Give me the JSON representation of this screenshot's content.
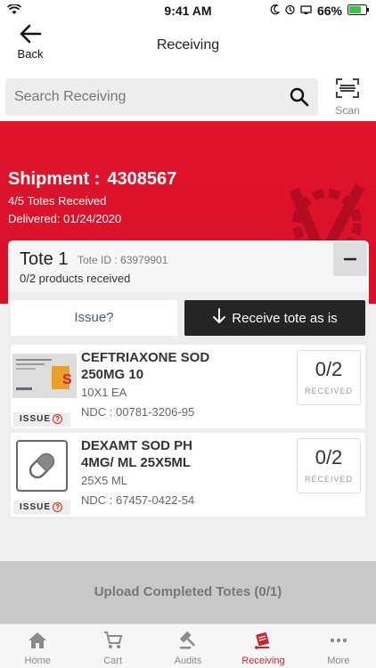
{
  "status_bar": {
    "time": "9:41 AM",
    "battery": "66%"
  },
  "nav": {
    "back_label": "Back",
    "title": "Receiving"
  },
  "search": {
    "placeholder": "Search Receiving",
    "scan_label": "Scan"
  },
  "shipment": {
    "label": "Shipment :",
    "number": "4308567",
    "totes_received": "4/5 Totes Received",
    "delivered": "Delivered: 01/24/2020"
  },
  "tote": {
    "title": "Tote 1",
    "tote_id": "Tote ID : 63979901",
    "progress": "0/2 products received",
    "collapse_symbol": "−",
    "issue_label": "Issue?",
    "receive_label": "Receive tote as is"
  },
  "products": [
    {
      "name": "CEFTRIAXONE SOD 250MG 10",
      "pack": "10X1 EA",
      "ndc": "NDC : 00781-3206-95",
      "count": "0/2",
      "count_label": "RECEIVED",
      "issue_tag": "ISSUE",
      "image": "ceftriaxone-box"
    },
    {
      "name": "DEXAMT SOD PH 4MG/ ML 25X5ML",
      "pack": "25X5 ML",
      "ndc": "NDC : 67457-0422-54",
      "count": "0/2",
      "count_label": "RECEIVED",
      "issue_tag": "ISSUE",
      "image": "pill-placeholder-icon"
    }
  ],
  "upload": {
    "label": "Upload Completed Totes (0/1)"
  },
  "tabs": [
    {
      "label": "Home",
      "icon": "home-icon"
    },
    {
      "label": "Cart",
      "icon": "cart-icon"
    },
    {
      "label": "Audits",
      "icon": "gavel-icon"
    },
    {
      "label": "Receiving",
      "icon": "receiving-icon",
      "active": true
    },
    {
      "label": "More",
      "icon": "more-icon"
    }
  ],
  "colors": {
    "accent": "#d21f2f",
    "hero": "#e0142c",
    "dark_button": "#252525"
  }
}
